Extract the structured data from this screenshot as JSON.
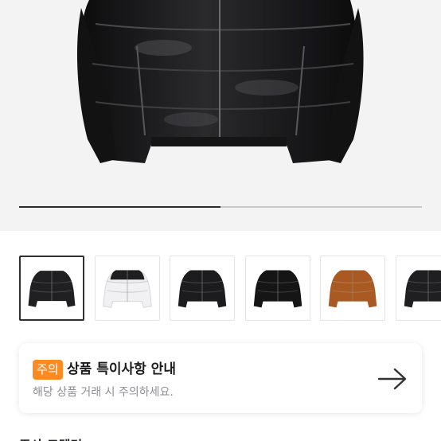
{
  "gallery": {
    "image_icon": "puffer-jacket-image",
    "progress_fraction": 0.5,
    "thumbnails": [
      {
        "color": "#202022",
        "style": "dark",
        "selected": true
      },
      {
        "color": "#f1f1f3",
        "style": "white-black",
        "selected": false
      },
      {
        "color": "#1c1c1e",
        "style": "dark",
        "selected": false
      },
      {
        "color": "#151516",
        "style": "dark",
        "selected": false
      },
      {
        "color": "#a85a22",
        "style": "brown",
        "selected": false
      },
      {
        "color": "#1f1f21",
        "style": "dark",
        "selected": false
      }
    ]
  },
  "notice": {
    "badge": "주의",
    "title": "상품 특이사항 안내",
    "subtitle": "해당 상품 거래 시 주의하세요.",
    "arrow_icon": "arrow-right-icon",
    "accent": "#ff8a1f"
  },
  "next_section": {
    "partial_label": "주사 모델명"
  }
}
